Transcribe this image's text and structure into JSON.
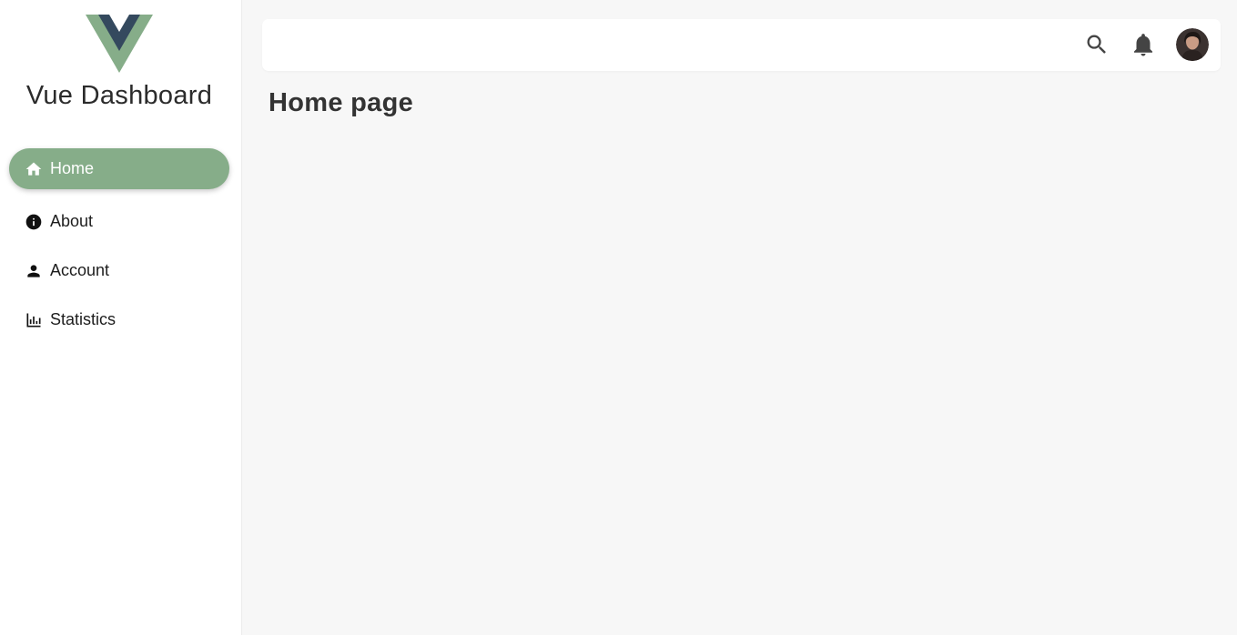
{
  "app": {
    "brand": "Vue Dashboard"
  },
  "sidebar": {
    "items": [
      {
        "label": "Home",
        "icon": "home-icon",
        "active": true
      },
      {
        "label": "About",
        "icon": "info-icon",
        "active": false
      },
      {
        "label": "Account",
        "icon": "person-icon",
        "active": false
      },
      {
        "label": "Statistics",
        "icon": "bar-chart-icon",
        "active": false
      }
    ]
  },
  "header": {
    "icons": [
      "search-icon",
      "bell-icon"
    ],
    "avatar": "user-avatar"
  },
  "main": {
    "title": "Home page"
  },
  "colors": {
    "accent": "#86ad89",
    "logo_green": "#86ad89",
    "logo_dark": "#34495e",
    "background": "#f7f7f7"
  }
}
